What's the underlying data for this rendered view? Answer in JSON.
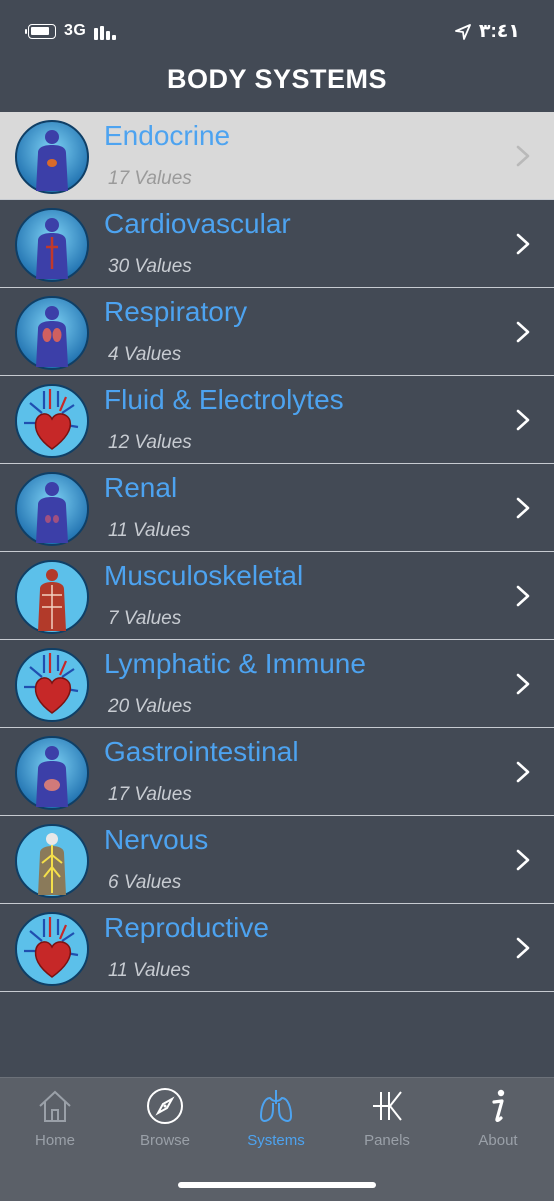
{
  "status": {
    "network": "3G",
    "time": "٣:٤١"
  },
  "header": {
    "title": "BODY SYSTEMS"
  },
  "systems": [
    {
      "name": "Endocrine",
      "count": "17 Values",
      "icon": "body-endocrine-icon",
      "selected": true
    },
    {
      "name": "Cardiovascular",
      "count": "30 Values",
      "icon": "body-cardiovascular-icon"
    },
    {
      "name": "Respiratory",
      "count": "4 Values",
      "icon": "body-respiratory-icon"
    },
    {
      "name": "Fluid & Electrolytes",
      "count": "12 Values",
      "icon": "heart-icon"
    },
    {
      "name": "Renal",
      "count": "11 Values",
      "icon": "body-renal-icon"
    },
    {
      "name": "Musculoskeletal",
      "count": "7 Values",
      "icon": "muscle-body-icon"
    },
    {
      "name": "Lymphatic & Immune",
      "count": "20 Values",
      "icon": "heart-icon"
    },
    {
      "name": "Gastrointestinal",
      "count": "17 Values",
      "icon": "body-gastrointestinal-icon"
    },
    {
      "name": "Nervous",
      "count": "6 Values",
      "icon": "nervous-system-icon"
    },
    {
      "name": "Reproductive",
      "count": "11 Values",
      "icon": "heart-icon"
    }
  ],
  "tabs": [
    {
      "label": "Home",
      "icon": "home-icon"
    },
    {
      "label": "Browse",
      "icon": "compass-icon"
    },
    {
      "label": "Systems",
      "icon": "lungs-icon",
      "active": true
    },
    {
      "label": "Panels",
      "icon": "panels-icon"
    },
    {
      "label": "About",
      "icon": "info-icon"
    }
  ],
  "colors": {
    "background": "#434a55",
    "accent": "#4da3f0",
    "selected_row": "#d9d9d9",
    "tab_bar": "#5b6068"
  }
}
